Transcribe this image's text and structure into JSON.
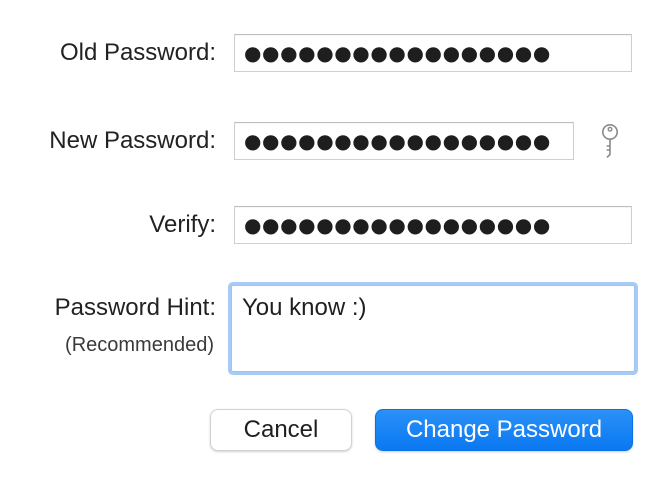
{
  "form": {
    "old_password": {
      "label": "Old Password:",
      "value": "●●●●●●●●●●●●●●●●●"
    },
    "new_password": {
      "label": "New Password:",
      "value": "●●●●●●●●●●●●●●●●●",
      "key_icon": "key-icon"
    },
    "verify": {
      "label": "Verify:",
      "value": "●●●●●●●●●●●●●●●●●"
    },
    "password_hint": {
      "label": "Password Hint:",
      "sublabel": "(Recommended)",
      "value": "You know :)",
      "focused": true
    }
  },
  "buttons": {
    "cancel_label": "Cancel",
    "change_label": "Change Password"
  },
  "colors": {
    "accent": "#0a7af2",
    "focus_ring": "#a8cbf5",
    "field_border": "#cfcfcf"
  }
}
